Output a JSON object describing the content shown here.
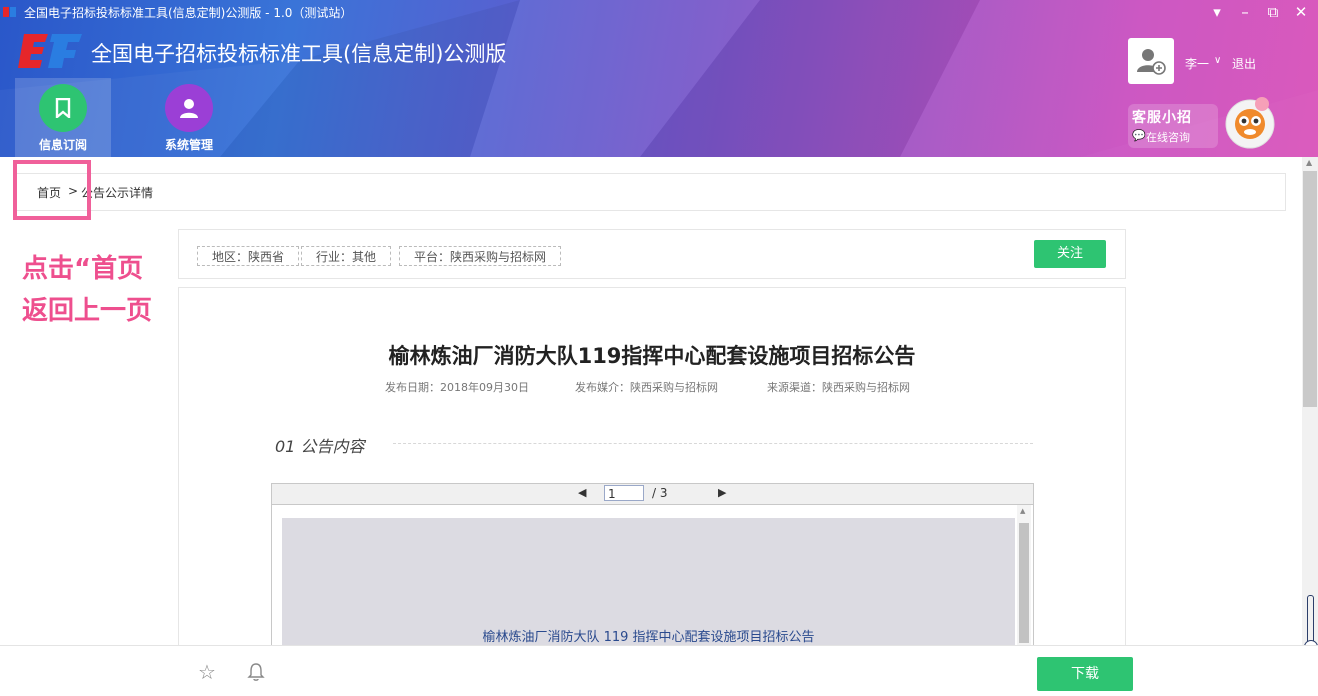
{
  "window": {
    "title": "全国电子招标投标标准工具(信息定制)公测版 - 1.0（测试站）",
    "controls": {
      "menu": "▾",
      "minimize": "–",
      "maximize": "⧉",
      "close": "✕"
    }
  },
  "app": {
    "name": "全国电子招标投标标准工具(信息定制)公测版",
    "nav": [
      {
        "label": "信息订阅",
        "icon": "bookmark-icon",
        "color": "#2ec472",
        "active": true
      },
      {
        "label": "系统管理",
        "icon": "user-icon",
        "color": "#9b3fd6",
        "active": false
      }
    ]
  },
  "user": {
    "name": "李一",
    "caret": "∨",
    "logout": "退出"
  },
  "service": {
    "title": "客服小招",
    "subtitle": "在线咨询",
    "icon": "chat-icon"
  },
  "breadcrumb": {
    "home": "首页",
    "separator": ">",
    "current": "公告公示详情"
  },
  "annotation": {
    "text": "点击“首页\n返回上一页",
    "color": "#ee4f8e"
  },
  "tags": {
    "region": "地区：陕西省",
    "industry": "行业：其他",
    "platform": "平台：陕西采购与招标网",
    "follow": "关注"
  },
  "notice": {
    "title": "榆林炼油厂消防大队119指挥中心配套设施项目招标公告",
    "publish_date": "发布日期：2018年09月30日",
    "media": "发布媒介：陕西采购与招标网",
    "source": "来源渠道：陕西采购与招标网",
    "section": "01 公告内容"
  },
  "pdf": {
    "current_page": "1",
    "total": "/ 3",
    "prev": "◀",
    "next": "▶",
    "page_title": "榆林炼油厂消防大队 119 指挥中心配套设施项目招标公告"
  },
  "bottom": {
    "download": "下载"
  },
  "colors": {
    "accent": "#2ec472",
    "annotation": "#f0609a"
  }
}
